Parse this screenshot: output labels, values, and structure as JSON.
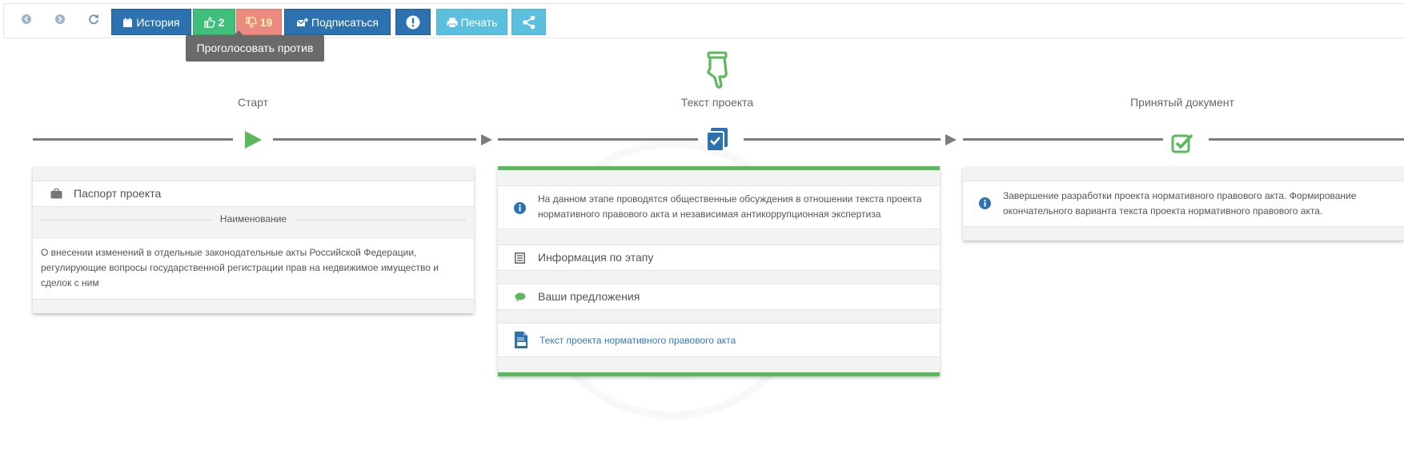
{
  "toolbar": {
    "back_icon": "arrow-left-circle-icon",
    "forward_icon": "arrow-right-circle-icon",
    "refresh_icon": "refresh-icon",
    "history_label": "История",
    "likes_count": "2",
    "dislikes_count": "19",
    "subscribe_label": "Подписаться",
    "print_label": "Печать",
    "colors": {
      "primary": "#2d72b0",
      "like": "#3fbf79",
      "dislike": "#ec8a80",
      "info": "#5bc0de"
    }
  },
  "tooltip": {
    "text": "Проголосовать против"
  },
  "timeline": {
    "stages": [
      {
        "title": "Старт",
        "icon": "play-icon"
      },
      {
        "title": "Текст проекта",
        "icon": "checked-document-icon",
        "active_marker_icon": "hand-pointing-down-icon"
      },
      {
        "title": "Принятый документ",
        "icon": "check-square-icon"
      }
    ],
    "accent_color": "#5cb85c"
  },
  "start_card": {
    "header_label": "Паспорт проекта",
    "section_label": "Наименование",
    "description": "О внесении изменений в отдельные законодательные акты Российской Федерации, регулирующие вопросы государственной регистрации прав на недвижимое имущество и сделок с ним",
    "description_lines": [
      "О внесении изменений в отдельные законодательные акты Российской Федерации,",
      "регулирующие вопросы государственной регистрации прав на недвижимое имущество и",
      "сделок с ним"
    ]
  },
  "text_card": {
    "info_lines": [
      "На данном этапе проводятся общественные обсуждения в отношении текста проекта",
      "нормативного правового акта и независимая антикоррупционная экспертиза"
    ],
    "stage_info_label": "Информация по этапу",
    "proposals_label": "Ваши предложения",
    "document_link": "Текст проекта нормативного правового акта"
  },
  "final_card": {
    "info_lines": [
      "Завершение разработки проекта нормативного правового акта. Формирование",
      "окончательного варианта текста проекта нормативного правового акта."
    ]
  }
}
